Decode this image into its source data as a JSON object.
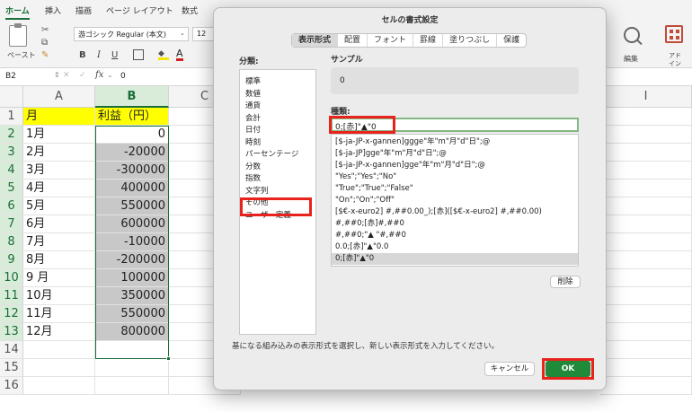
{
  "ribbon": {
    "tabs": [
      "ホーム",
      "挿入",
      "描画",
      "ページ レイアウト",
      "数式"
    ],
    "paste_label": "ペースト",
    "font_name": "游ゴシック Regular (本文)",
    "font_size": "12",
    "bold": "B",
    "italic": "I",
    "underline": "U",
    "font_color_glyph": "A",
    "edit_label": "編集",
    "addin_label": "アド イン"
  },
  "formula_bar": {
    "name_box": "B2",
    "fx": "fx",
    "value": "0"
  },
  "sheet": {
    "columns": [
      "A",
      "B",
      "C",
      "I"
    ],
    "rows": [
      "1",
      "2",
      "3",
      "4",
      "5",
      "6",
      "7",
      "8",
      "9",
      "10",
      "11",
      "12",
      "13",
      "14",
      "15",
      "16"
    ],
    "header_month": "月",
    "header_profit": "利益（円）",
    "data": [
      {
        "month": "1月",
        "profit": "0"
      },
      {
        "month": "2月",
        "profit": "-20000"
      },
      {
        "month": "3月",
        "profit": "-300000"
      },
      {
        "month": "4月",
        "profit": "400000"
      },
      {
        "month": "5月",
        "profit": "550000"
      },
      {
        "month": "6月",
        "profit": "600000"
      },
      {
        "month": "7月",
        "profit": "-10000"
      },
      {
        "month": "8月",
        "profit": "-200000"
      },
      {
        "month": "9 月",
        "profit": "100000"
      },
      {
        "month": "10月",
        "profit": "350000"
      },
      {
        "month": "11月",
        "profit": "550000"
      },
      {
        "month": "12月",
        "profit": "800000"
      }
    ]
  },
  "dialog": {
    "title": "セルの書式設定",
    "tabs": [
      "表示形式",
      "配置",
      "フォント",
      "罫線",
      "塗りつぶし",
      "保護"
    ],
    "active_tab": "表示形式",
    "category_label": "分類:",
    "categories": [
      "標準",
      "数値",
      "通貨",
      "会計",
      "日付",
      "時刻",
      "パーセンテージ",
      "分数",
      "指数",
      "文字列",
      "その他",
      "ユーザー定義"
    ],
    "selected_category": "ユーザー定義",
    "sample_label": "サンプル",
    "sample_value": "0",
    "type_label": "種類:",
    "type_value": "0;[赤]\"▲\"0",
    "type_list": [
      "[$-ja-JP-x-gannen]ggge\"年\"m\"月\"d\"日\";@",
      "[$-ja-JP]gge\"年\"m\"月\"d\"日\";@",
      "[$-ja-JP-x-gannen]gge\"年\"m\"月\"d\"日\";@",
      "\"Yes\";\"Yes\";\"No\"",
      "\"True\";\"True\";\"False\"",
      "\"On\";\"On\";\"Off\"",
      "[$€-x-euro2] #,##0.00_);[赤]([$€-x-euro2] #,##0.00)",
      "#,##0;[赤]#,##0",
      "#,##0;\"▲ \"#,##0",
      "0.0;[赤]\"▲\"0.0",
      "0;[赤]\"▲\"0"
    ],
    "delete_label": "削除",
    "description": "基になる組み込みの表示形式を選択し、新しい表示形式を入力してください。",
    "cancel_label": "キャンセル",
    "ok_label": "OK"
  },
  "colors": {
    "accent_green": "#1a6e39",
    "ok_green": "#1f8a3a",
    "highlight_red": "#e8231d",
    "header_yellow": "#ffff00",
    "cell_gray": "#c8c8c8"
  }
}
